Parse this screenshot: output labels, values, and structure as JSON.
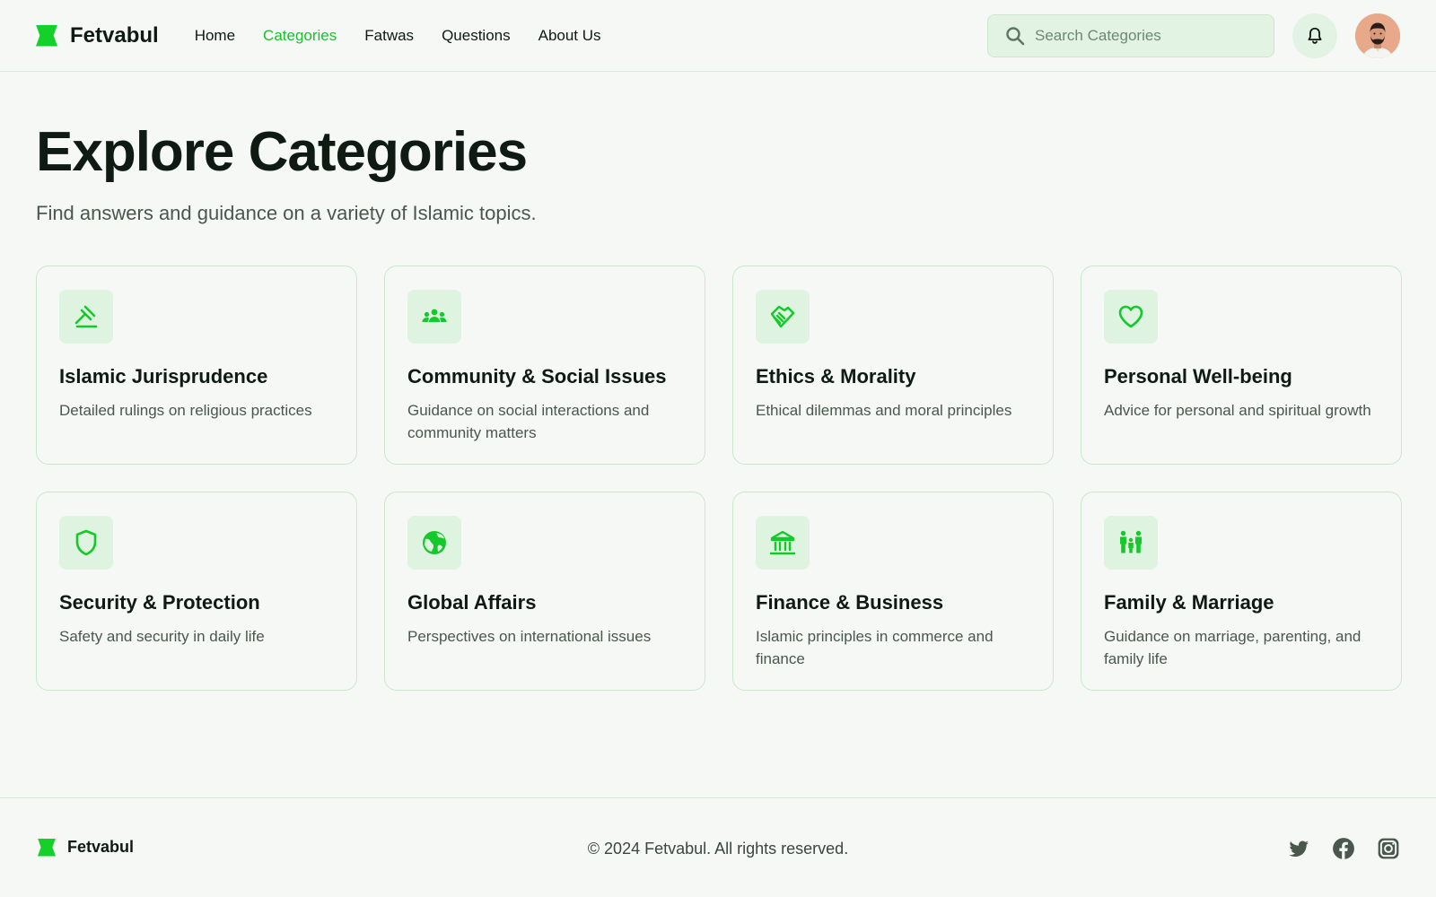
{
  "brand": {
    "name": "Fetvabul",
    "accent": "#14d12a"
  },
  "nav": [
    {
      "label": "Home",
      "active": false
    },
    {
      "label": "Categories",
      "active": true
    },
    {
      "label": "Fatwas",
      "active": false
    },
    {
      "label": "Questions",
      "active": false
    },
    {
      "label": "About Us",
      "active": false
    }
  ],
  "search": {
    "placeholder": "Search Categories",
    "value": ""
  },
  "header_icons": {
    "notifications": "bell-icon",
    "profile": "avatar"
  },
  "page": {
    "title": "Explore Categories",
    "subtitle": "Find answers and guidance on a variety of Islamic topics."
  },
  "categories": [
    {
      "icon": "gavel-icon",
      "title": "Islamic Jurisprudence",
      "desc": "Detailed rulings on religious practices"
    },
    {
      "icon": "group-icon",
      "title": "Community & Social Issues",
      "desc": "Guidance on social interactions and community matters"
    },
    {
      "icon": "handshake-icon",
      "title": "Ethics & Morality",
      "desc": "Ethical dilemmas and moral principles"
    },
    {
      "icon": "heart-icon",
      "title": "Personal Well-being",
      "desc": "Advice for personal and spiritual growth"
    },
    {
      "icon": "shield-icon",
      "title": "Security & Protection",
      "desc": "Safety and security in daily life"
    },
    {
      "icon": "globe-icon",
      "title": "Global Affairs",
      "desc": "Perspectives on international issues"
    },
    {
      "icon": "bank-icon",
      "title": "Finance & Business",
      "desc": "Islamic principles in commerce and finance"
    },
    {
      "icon": "family-icon",
      "title": "Family & Marriage",
      "desc": "Guidance on marriage, parenting, and family life"
    }
  ],
  "footer": {
    "brand": "Fetvabul",
    "copyright": "© 2024 Fetvabul. All rights reserved.",
    "socials": [
      "twitter-icon",
      "facebook-icon",
      "instagram-icon"
    ]
  }
}
